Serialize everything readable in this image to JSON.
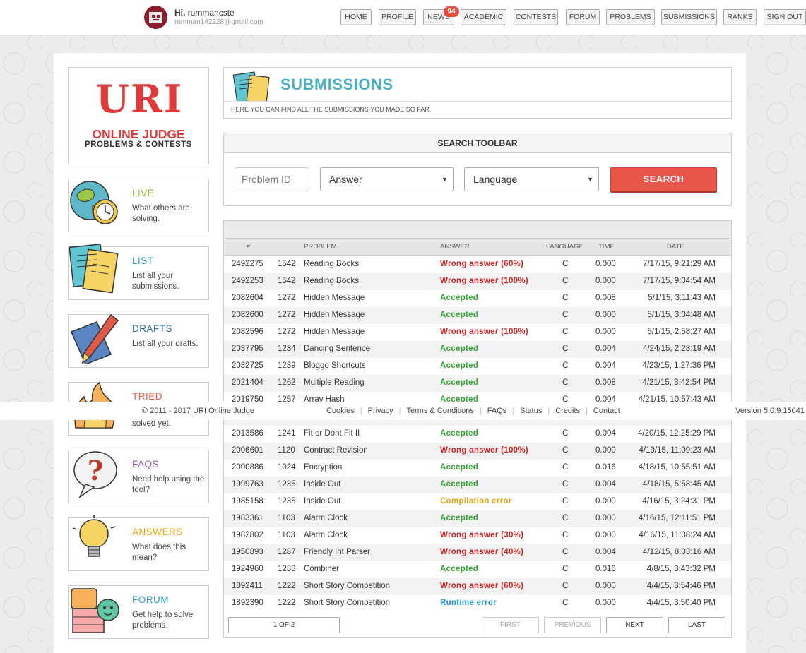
{
  "user": {
    "greeting": "Hi,",
    "name": "rummancste",
    "email": "rumman142228@gmail.com"
  },
  "nav": [
    {
      "label": "HOME"
    },
    {
      "label": "PROFILE"
    },
    {
      "label": "NEWS"
    },
    {
      "label": "ACADEMIC"
    },
    {
      "label": "CONTESTS"
    },
    {
      "label": "FORUM"
    },
    {
      "label": "PROBLEMS"
    },
    {
      "label": "SUBMISSIONS"
    },
    {
      "label": "RANKS"
    },
    {
      "label": "SIGN OUT"
    }
  ],
  "news_badge": "94",
  "logo": {
    "title": "URI",
    "line1": "ONLINE JUDGE",
    "line2": "PROBLEMS & CONTESTS"
  },
  "side": [
    {
      "title": "LIVE",
      "desc": "What others are solving.",
      "color": "#8dc63f",
      "icon": "globe-clock-icon"
    },
    {
      "title": "LIST",
      "desc": "List all your submissions.",
      "color": "#2a9fc7",
      "icon": "list-papers-icon"
    },
    {
      "title": "DRAFTS",
      "desc": "List all your drafts.",
      "color": "#2a6fa8",
      "icon": "pen-icon"
    },
    {
      "title": "TRIED",
      "desc": "solved yet.",
      "color": "#e9573f",
      "icon": "fire-icon"
    },
    {
      "title": "FAQS",
      "desc": "Need help using the tool?",
      "color": "#9b59b6",
      "icon": "question-bubble-icon"
    },
    {
      "title": "ANSWERS",
      "desc": "What does this mean?",
      "color": "#f0a500",
      "icon": "lightbulb-icon"
    },
    {
      "title": "FORUM",
      "desc": "Get help to solve problems.",
      "color": "#2a9fc7",
      "icon": "chat-bubbles-icon"
    }
  ],
  "header": {
    "title": "SUBMISSIONS",
    "subtitle": "HERE YOU CAN FIND ALL THE SUBMISSIONS YOU MADE SO FAR."
  },
  "search": {
    "heading": "SEARCH TOOLBAR",
    "problem_placeholder": "Problem ID",
    "answer_value": "Answer",
    "language_value": "Language",
    "button": "SEARCH"
  },
  "table": {
    "headers": {
      "id": "#",
      "problem": "PROBLEM",
      "answer": "ANSWER",
      "language": "LANGUAGE",
      "time": "TIME",
      "date": "DATE"
    },
    "rows": [
      {
        "id": "2492275",
        "pnum": "1542",
        "problem": "Reading Books",
        "answer": "Wrong answer (60%)",
        "status": "wa",
        "lang": "C",
        "time": "0.000",
        "date": "7/17/15, 9:21:29 AM"
      },
      {
        "id": "2492253",
        "pnum": "1542",
        "problem": "Reading Books",
        "answer": "Wrong answer (100%)",
        "status": "wa",
        "lang": "C",
        "time": "0.000",
        "date": "7/17/15, 9:04:54 AM"
      },
      {
        "id": "2082604",
        "pnum": "1272",
        "problem": "Hidden Message",
        "answer": "Accepted",
        "status": "ok",
        "lang": "C",
        "time": "0.008",
        "date": "5/1/15, 3:11:43 AM"
      },
      {
        "id": "2082600",
        "pnum": "1272",
        "problem": "Hidden Message",
        "answer": "Accepted",
        "status": "ok",
        "lang": "C",
        "time": "0.000",
        "date": "5/1/15, 3:04:48 AM"
      },
      {
        "id": "2082596",
        "pnum": "1272",
        "problem": "Hidden Message",
        "answer": "Wrong answer (100%)",
        "status": "wa",
        "lang": "C",
        "time": "0.000",
        "date": "5/1/15, 2:58:27 AM"
      },
      {
        "id": "2037795",
        "pnum": "1234",
        "problem": "Dancing Sentence",
        "answer": "Accepted",
        "status": "ok",
        "lang": "C",
        "time": "0.004",
        "date": "4/24/15, 2:28:19 AM"
      },
      {
        "id": "2032725",
        "pnum": "1239",
        "problem": "Bloggo Shortcuts",
        "answer": "Accepted",
        "status": "ok",
        "lang": "C",
        "time": "0.004",
        "date": "4/23/15, 1:27:36 PM"
      },
      {
        "id": "2021404",
        "pnum": "1262",
        "problem": "Multiple Reading",
        "answer": "Accepted",
        "status": "ok",
        "lang": "C",
        "time": "0.008",
        "date": "4/21/15, 3:42:54 PM"
      },
      {
        "id": "2019750",
        "pnum": "1257",
        "problem": "Array Hash",
        "answer": "Accepted",
        "status": "ok",
        "lang": "C",
        "time": "0.004",
        "date": "4/21/15, 10:57:43 AM"
      },
      {
        "id": "",
        "pnum": "",
        "problem": "",
        "answer": "",
        "status": "",
        "lang": "",
        "time": "",
        "date": ""
      },
      {
        "id": "2013586",
        "pnum": "1241",
        "problem": "Fit or Dont Fit II",
        "answer": "Accepted",
        "status": "ok",
        "lang": "C",
        "time": "0.004",
        "date": "4/20/15, 12:25:29 PM"
      },
      {
        "id": "2006601",
        "pnum": "1120",
        "problem": "Contract Revision",
        "answer": "Wrong answer (100%)",
        "status": "wa",
        "lang": "C",
        "time": "0.000",
        "date": "4/19/15, 11:09:23 AM"
      },
      {
        "id": "2000886",
        "pnum": "1024",
        "problem": "Encryption",
        "answer": "Accepted",
        "status": "ok",
        "lang": "C",
        "time": "0.016",
        "date": "4/18/15, 10:55:51 AM"
      },
      {
        "id": "1999763",
        "pnum": "1235",
        "problem": "Inside Out",
        "answer": "Accepted",
        "status": "ok",
        "lang": "C",
        "time": "0.004",
        "date": "4/18/15, 5:58:45 AM"
      },
      {
        "id": "1985158",
        "pnum": "1235",
        "problem": "Inside Out",
        "answer": "Compilation error",
        "status": "ce",
        "lang": "C",
        "time": "0.000",
        "date": "4/16/15, 3:24:31 PM"
      },
      {
        "id": "1983361",
        "pnum": "1103",
        "problem": "Alarm Clock",
        "answer": "Accepted",
        "status": "ok",
        "lang": "C",
        "time": "0.000",
        "date": "4/16/15, 12:11:51 PM"
      },
      {
        "id": "1982802",
        "pnum": "1103",
        "problem": "Alarm Clock",
        "answer": "Wrong answer (30%)",
        "status": "wa",
        "lang": "C",
        "time": "0.000",
        "date": "4/16/15, 11:08:24 AM"
      },
      {
        "id": "1950893",
        "pnum": "1287",
        "problem": "Friendly Int Parser",
        "answer": "Wrong answer (40%)",
        "status": "wa",
        "lang": "C",
        "time": "0.004",
        "date": "4/12/15, 8:03:16 AM"
      },
      {
        "id": "1924960",
        "pnum": "1238",
        "problem": "Combiner",
        "answer": "Accepted",
        "status": "ok",
        "lang": "C",
        "time": "0.016",
        "date": "4/8/15, 3:43:32 PM"
      },
      {
        "id": "1892411",
        "pnum": "1222",
        "problem": "Short Story Competition",
        "answer": "Wrong answer (60%)",
        "status": "wa",
        "lang": "C",
        "time": "0.000",
        "date": "4/4/15, 3:54:46 PM"
      },
      {
        "id": "1892390",
        "pnum": "1222",
        "problem": "Short Story Competition",
        "answer": "Runtime error",
        "status": "re",
        "lang": "C",
        "time": "0.000",
        "date": "4/4/15, 3:50:40 PM"
      }
    ]
  },
  "pager": {
    "current": "1 OF 2",
    "first": "FIRST",
    "previous": "PREVIOUS",
    "next": "NEXT",
    "last": "LAST"
  },
  "footer": {
    "copyright": "© 2011 - 2017 URI Online Judge",
    "links": [
      "Cookies",
      "Privacy",
      "Terms & Conditions",
      "FAQs",
      "Status",
      "Credits",
      "Contact"
    ],
    "version": "Version 5.0.9.15041"
  },
  "colors": {
    "accent": "#4ab0c1",
    "search_button": "#e8574a",
    "accepted": "#2fa62f",
    "wrong": "#d41e1e",
    "compile_error": "#e6a117",
    "runtime_error": "#2196c9"
  }
}
